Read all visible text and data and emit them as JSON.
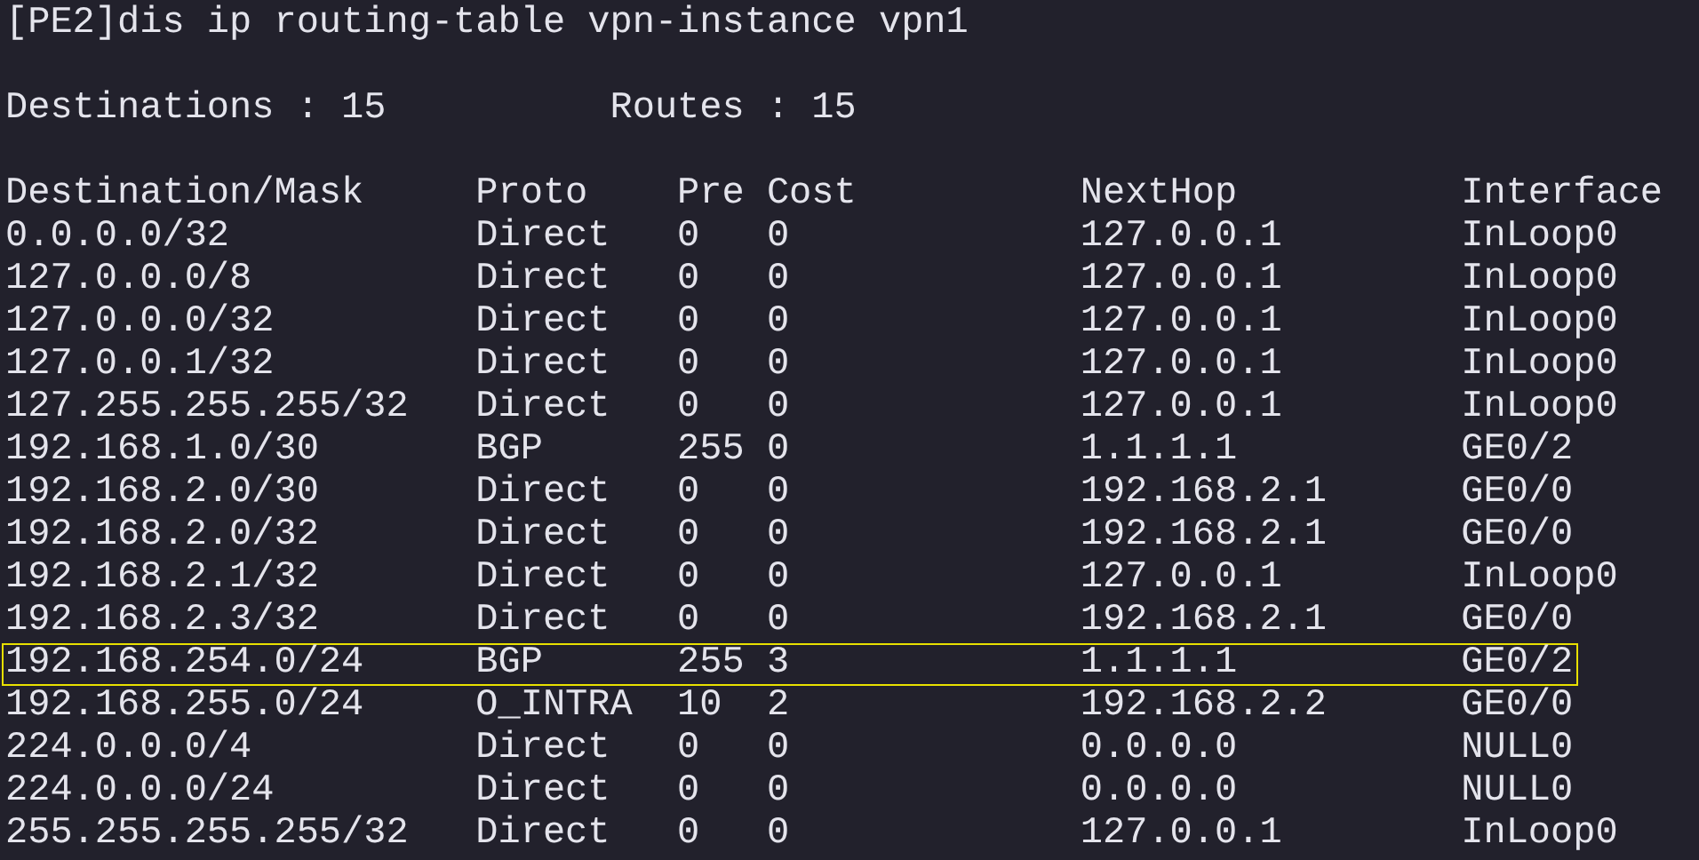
{
  "command": "[PE2]dis ip routing-table vpn-instance vpn1",
  "summary": {
    "destinations": "Destinations : 15",
    "routes": "Routes : 15"
  },
  "table": {
    "columns": [
      "Destination/Mask",
      "Proto",
      "Pre",
      "Cost",
      "NextHop",
      "Interface"
    ],
    "rows": [
      {
        "cells": [
          "0.0.0.0/32",
          "Direct",
          "0",
          "0",
          "127.0.0.1",
          "InLoop0"
        ],
        "highlighted": false
      },
      {
        "cells": [
          "127.0.0.0/8",
          "Direct",
          "0",
          "0",
          "127.0.0.1",
          "InLoop0"
        ],
        "highlighted": false
      },
      {
        "cells": [
          "127.0.0.0/32",
          "Direct",
          "0",
          "0",
          "127.0.0.1",
          "InLoop0"
        ],
        "highlighted": false
      },
      {
        "cells": [
          "127.0.0.1/32",
          "Direct",
          "0",
          "0",
          "127.0.0.1",
          "InLoop0"
        ],
        "highlighted": false
      },
      {
        "cells": [
          "127.255.255.255/32",
          "Direct",
          "0",
          "0",
          "127.0.0.1",
          "InLoop0"
        ],
        "highlighted": false
      },
      {
        "cells": [
          "192.168.1.0/30",
          "BGP",
          "255",
          "0",
          "1.1.1.1",
          "GE0/2"
        ],
        "highlighted": false
      },
      {
        "cells": [
          "192.168.2.0/30",
          "Direct",
          "0",
          "0",
          "192.168.2.1",
          "GE0/0"
        ],
        "highlighted": false
      },
      {
        "cells": [
          "192.168.2.0/32",
          "Direct",
          "0",
          "0",
          "192.168.2.1",
          "GE0/0"
        ],
        "highlighted": false
      },
      {
        "cells": [
          "192.168.2.1/32",
          "Direct",
          "0",
          "0",
          "127.0.0.1",
          "InLoop0"
        ],
        "highlighted": false
      },
      {
        "cells": [
          "192.168.2.3/32",
          "Direct",
          "0",
          "0",
          "192.168.2.1",
          "GE0/0"
        ],
        "highlighted": false
      },
      {
        "cells": [
          "192.168.254.0/24",
          "BGP",
          "255",
          "3",
          "1.1.1.1",
          "GE0/2"
        ],
        "highlighted": true
      },
      {
        "cells": [
          "192.168.255.0/24",
          "O_INTRA",
          "10",
          "2",
          "192.168.2.2",
          "GE0/0"
        ],
        "highlighted": false
      },
      {
        "cells": [
          "224.0.0.0/4",
          "Direct",
          "0",
          "0",
          "0.0.0.0",
          "NULL0"
        ],
        "highlighted": false
      },
      {
        "cells": [
          "224.0.0.0/24",
          "Direct",
          "0",
          "0",
          "0.0.0.0",
          "NULL0"
        ],
        "highlighted": false
      },
      {
        "cells": [
          "255.255.255.255/32",
          "Direct",
          "0",
          "0",
          "127.0.0.1",
          "InLoop0"
        ],
        "highlighted": false
      }
    ]
  }
}
